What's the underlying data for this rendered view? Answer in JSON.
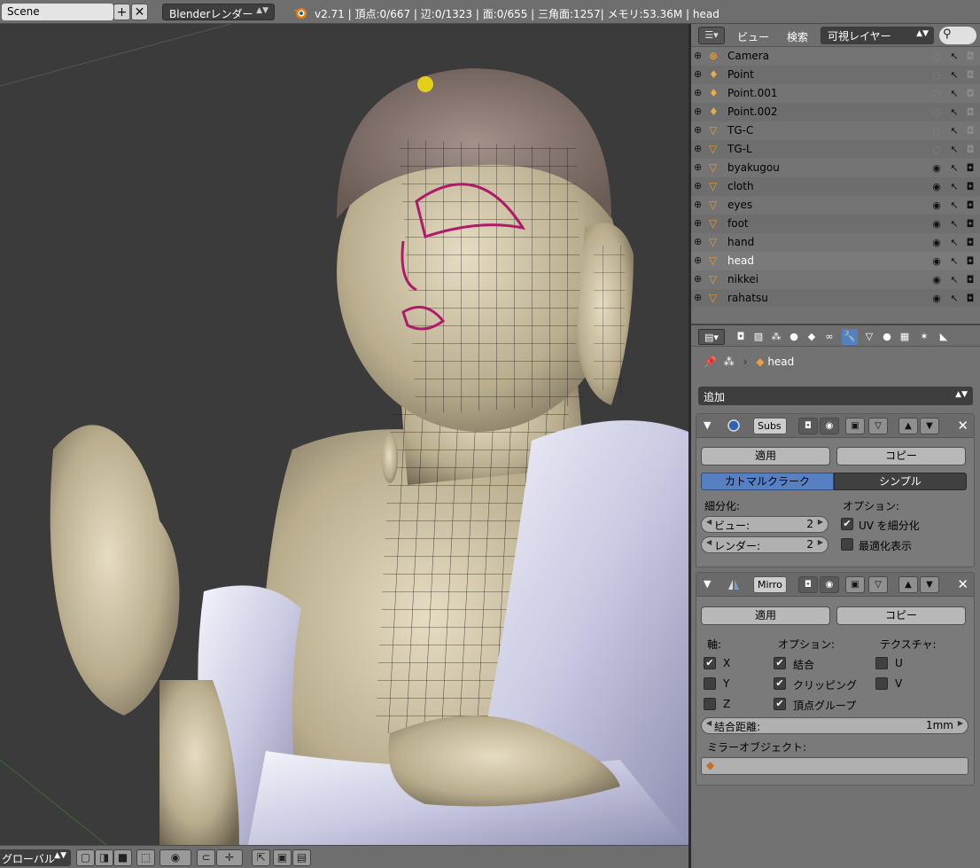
{
  "header": {
    "scene_name": "Scene",
    "add_scene_icon": "plus-icon",
    "remove_scene_icon": "close-icon",
    "render_engine": "Blenderレンダー",
    "stats": "v2.71 | 頂点:0/667 | 辺:0/1323 | 面:0/655 | 三角面:1257| メモリ:53.36M | head"
  },
  "viewport_footer": {
    "orientation": "グローバル"
  },
  "outliner": {
    "menu_view": "ビュー",
    "menu_search": "検索",
    "layer_filter": "可視レイヤー",
    "items": [
      {
        "name": "Camera",
        "type": "camera",
        "visible": false
      },
      {
        "name": "Point",
        "type": "lamp",
        "visible": false
      },
      {
        "name": "Point.001",
        "type": "lamp",
        "visible": false
      },
      {
        "name": "Point.002",
        "type": "lamp",
        "visible": false
      },
      {
        "name": "TG-C",
        "type": "mesh",
        "visible": false
      },
      {
        "name": "TG-L",
        "type": "mesh",
        "visible": false
      },
      {
        "name": "byakugou",
        "type": "mesh",
        "visible": true
      },
      {
        "name": "cloth",
        "type": "mesh",
        "visible": true
      },
      {
        "name": "eyes",
        "type": "mesh",
        "visible": true
      },
      {
        "name": "foot",
        "type": "mesh",
        "visible": true
      },
      {
        "name": "hand",
        "type": "mesh",
        "visible": true
      },
      {
        "name": "head",
        "type": "mesh",
        "visible": true,
        "active": true
      },
      {
        "name": "nikkei",
        "type": "mesh",
        "visible": true
      },
      {
        "name": "rahatsu",
        "type": "mesh",
        "visible": true
      }
    ]
  },
  "properties": {
    "active_tab": "modifiers",
    "breadcrumb_object": "head",
    "add_modifier": "追加",
    "subsurf": {
      "name": "Subs",
      "apply": "適用",
      "copy": "コピー",
      "mode_catmull": "カトマルクラーク",
      "mode_simple": "シンプル",
      "subdivisions_label": "細分化:",
      "view_label": "ビュー:",
      "view_value": "2",
      "render_label": "レンダー:",
      "render_value": "2",
      "options_label": "オプション:",
      "subdivide_uvs": "UV を細分化",
      "subdivide_uvs_checked": true,
      "optimal_display": "最適化表示",
      "optimal_display_checked": false
    },
    "mirror": {
      "name": "Mirro",
      "apply": "適用",
      "copy": "コピー",
      "axis_label": "軸:",
      "axis_x": "X",
      "axis_y": "Y",
      "axis_z": "Z",
      "options_label": "オプション:",
      "merge": "結合",
      "clipping": "クリッピング",
      "vertex_groups": "頂点グループ",
      "texture_label": "テクスチャ:",
      "tex_u": "U",
      "tex_v": "V",
      "merge_limit_label": "結合距離:",
      "merge_limit_value": "1mm",
      "mirror_object_label": "ミラーオブジェクト:"
    }
  }
}
